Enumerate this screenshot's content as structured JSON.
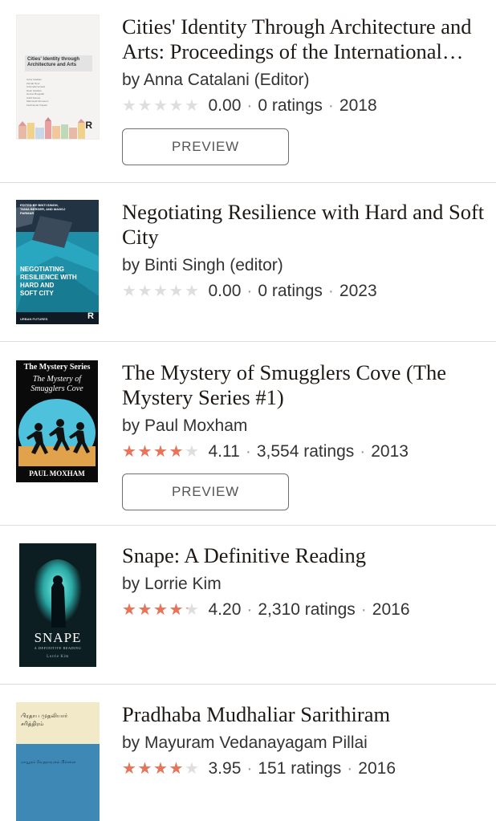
{
  "books": [
    {
      "title": "Cities' Identity Through Architecture and Arts: Proceedings of the International Conference",
      "author": "by Anna Catalani (Editor)",
      "rating": "0.00",
      "rating_value": 0,
      "ratings_count": "0 ratings",
      "year": "2018",
      "preview_label": "PREVIEW",
      "cover": {
        "title_text": "Cities' Identity through Architecture and Arts",
        "editors": [
          "Anna Catalani",
          "Zeinab Nour",
          "Antonella Versaci",
          "Dean Hawkes",
          "Hocine Bougdah",
          "Adolf Sotoca",
          "Mahmoud Ghoneem",
          "Ferdinando Trapani"
        ],
        "logo": "R"
      }
    },
    {
      "title": "Negotiating Resilience with Hard and Soft City",
      "author": "by Binti Singh (editor)",
      "rating": "0.00",
      "rating_value": 0,
      "ratings_count": "0 ratings",
      "year": "2023",
      "cover": {
        "editors_line": "EDITED BY BINTI SINGH, TANIA BERGER, AND MANOJ PARMAR",
        "title_lines": [
          "NEGOTIATING",
          "RESILIENCE WITH",
          "HARD AND",
          "SOFT CITY"
        ],
        "series": "URBAN FUTURES",
        "logo": "R"
      }
    },
    {
      "title": "The Mystery of Smugglers Cove (The Mystery Series #1)",
      "author": "by Paul Moxham",
      "rating": "4.11",
      "rating_value": 4.11,
      "ratings_count": "3,554 ratings",
      "year": "2013",
      "preview_label": "PREVIEW",
      "cover": {
        "series": "The Mystery Series",
        "title_lines": [
          "The Mystery of",
          "Smugglers Cove"
        ],
        "author": "PAUL MOXHAM"
      }
    },
    {
      "title": "Snape: A Definitive Reading",
      "author": "by Lorrie Kim",
      "rating": "4.20",
      "rating_value": 4.2,
      "ratings_count": "2,310 ratings",
      "year": "2016",
      "cover": {
        "title": "SNAPE",
        "subtitle": "A DEFINITIVE READING",
        "author": "Lorrie Kim"
      }
    },
    {
      "title": "Pradhaba Mudhaliar Sarithiram",
      "author": "by Mayuram Vedanayagam Pillai",
      "rating": "3.95",
      "rating_value": 3.95,
      "ratings_count": "151 ratings",
      "year": "2016",
      "cover": {
        "title_lines": [
          "பிரதாப முதலியார்",
          "சரித்திரம்"
        ],
        "author": "மாயூரம் வேதநாயகம் பிள்ளை"
      }
    }
  ],
  "colors": {
    "star_filled": "#e87358",
    "star_empty": "#dedede",
    "divider": "#dcdcdc"
  }
}
